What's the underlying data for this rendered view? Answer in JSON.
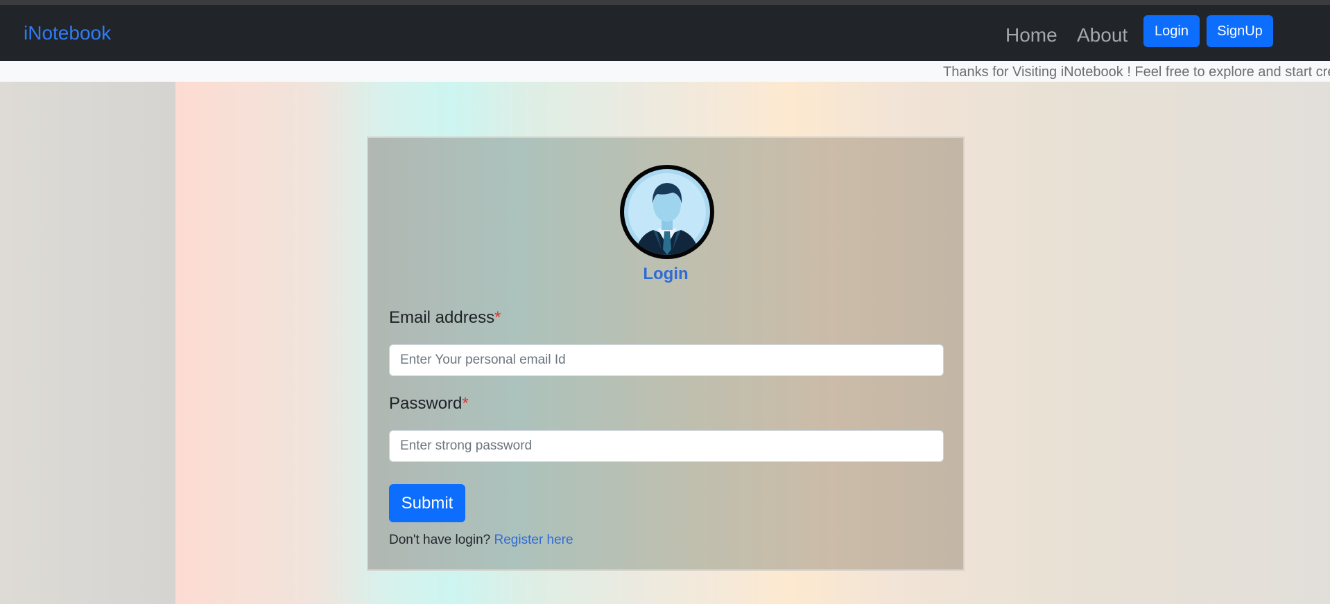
{
  "navbar": {
    "brand": "iNotebook",
    "links": [
      "Home",
      "About"
    ],
    "buttons": [
      "Login",
      "SignUp"
    ]
  },
  "marquee": {
    "text": "Thanks for Visiting iNotebook ! Feel free to explore and start creating your notes"
  },
  "login_card": {
    "avatar_icon": "user-avatar-icon",
    "title": "Login",
    "email": {
      "label": "Email address",
      "required_mark": "*",
      "placeholder": "Enter Your personal email Id",
      "value": ""
    },
    "password": {
      "label": "Password",
      "required_mark": "*",
      "placeholder": "Enter strong password",
      "value": ""
    },
    "submit_label": "Submit",
    "register_prompt": "Don't have login?",
    "register_link": "Register here"
  },
  "colors": {
    "navbar_bg": "#212529",
    "brand": "#2f7cf6",
    "primary": "#0d6efd",
    "required": "#e0332b",
    "title": "#2f6bd6"
  }
}
